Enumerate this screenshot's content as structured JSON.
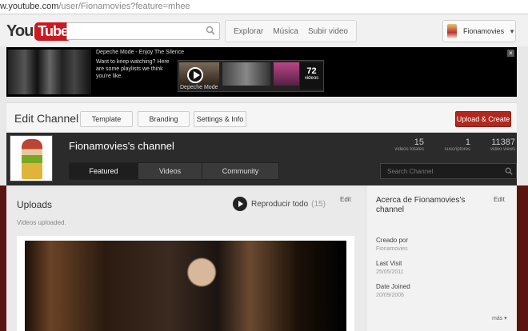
{
  "browser": {
    "url_visible": "w.youtube.com",
    "url_rest": "/user/Fionamovies?feature=mhee"
  },
  "masthead": {
    "logo_you": "You",
    "logo_tube": "Tube",
    "nav": [
      "Explorar",
      "Música",
      "Subir video"
    ],
    "user_name": "Fionamovies"
  },
  "promo": {
    "title": "Depeche Mode - Enjoy The Silence",
    "body": "Want to keep watching? Here are some playlists we think you're like.",
    "count": "72",
    "count_label": "videos",
    "caption": "Depeche Mode",
    "close": "×"
  },
  "edit_bar": {
    "title": "Edit Channel",
    "buttons": [
      "Template",
      "Branding",
      "Settings & Info"
    ],
    "upload": "Upload & Create"
  },
  "channel": {
    "title": "Fionamovies's channel",
    "tabs": [
      "Featured",
      "Videos",
      "Community"
    ],
    "search_placeholder": "Search Channel",
    "stats": [
      {
        "value": "15",
        "label": "videos totales"
      },
      {
        "value": "1",
        "label": "suscriptores"
      },
      {
        "value": "11387",
        "label": "video views"
      }
    ]
  },
  "uploads": {
    "heading": "Uploads",
    "sub": "Videos uploaded.",
    "play_all": "Reproducir todo",
    "play_all_count": "(15)",
    "edit": "Edit"
  },
  "about": {
    "title": "Acerca de Fionamovies's channel",
    "edit": "Edit",
    "created_label": "Creado por",
    "created_value": "Fionamovies",
    "last_visit_label": "Last Visit",
    "last_visit_value": "25/05/2011",
    "joined_label": "Date Joined",
    "joined_value": "20/09/2006",
    "more": "más ▾"
  }
}
